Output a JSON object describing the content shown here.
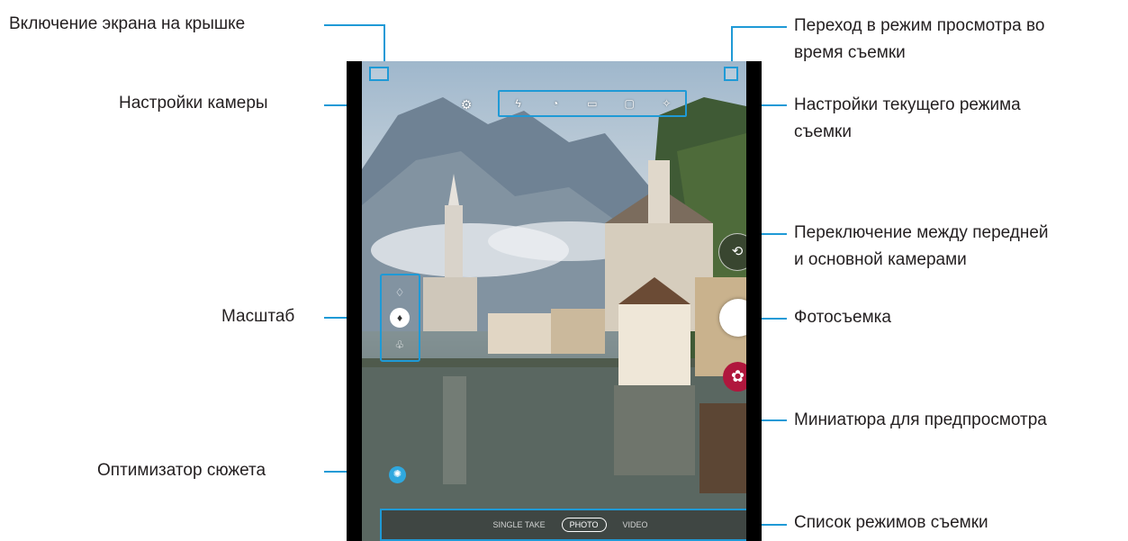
{
  "callouts": {
    "cover_screen": "Включение экрана на крышке",
    "camera_settings": "Настройки камеры",
    "zoom": "Масштаб",
    "scene_optimizer": "Оптимизатор сюжета",
    "view_mode_line1": "Переход в режим просмотра во",
    "view_mode_line2": "время съемки",
    "mode_settings_line1": "Настройки текущего режима",
    "mode_settings_line2": "съемки",
    "switch_camera_line1": "Переключение между передней",
    "switch_camera_line2": "и основной камерами",
    "take_photo": "Фотосъемка",
    "preview_thumbnail": "Миниатюра для предпросмотра",
    "mode_list": "Список режимов съемки"
  },
  "screen": {
    "modes": [
      "SINGLE TAKE",
      "PHOTO",
      "VIDEO"
    ],
    "active_mode_index": 1,
    "top_icons": [
      "flash-off-icon",
      "timer-icon",
      "ratio-icon",
      "motion-photo-icon",
      "effects-icon"
    ]
  },
  "colors": {
    "callout_line": "#1f9ad6",
    "thumbnail": "#b0173d",
    "optimizer": "#2fa8df"
  }
}
